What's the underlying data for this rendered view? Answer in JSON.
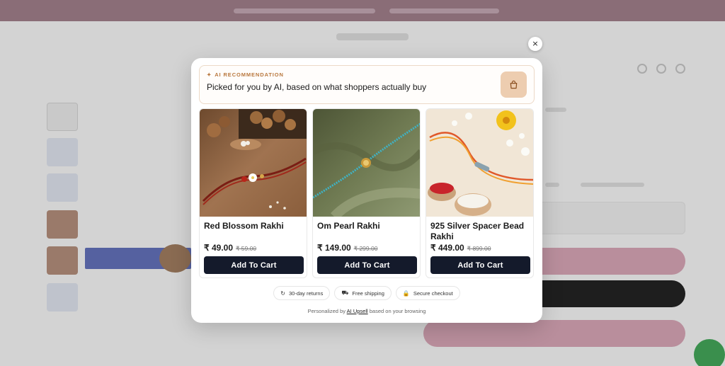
{
  "modal": {
    "close_label": "×",
    "eyebrow_icon": "✦",
    "eyebrow": "AI RECOMMENDATION",
    "headline": "Picked for you by AI, based on what shoppers actually buy",
    "bag_icon": "shopping-bag-icon",
    "products": [
      {
        "name": "Red Blossom Rakhi",
        "price": "₹ 49.00",
        "was": "₹ 59.00",
        "cta": "Add To Cart"
      },
      {
        "name": "Om Pearl Rakhi",
        "price": "₹ 149.00",
        "was": "₹ 299.00",
        "cta": "Add To Cart"
      },
      {
        "name": "925 Silver Spacer Bead Rakhi",
        "price": "₹ 449.00",
        "was": "₹ 899.00",
        "cta": "Add To Cart"
      }
    ],
    "badges": [
      {
        "icon": "↻",
        "label": "30-day returns"
      },
      {
        "icon": "⛟",
        "label": "Free shipping"
      },
      {
        "icon": "🔒",
        "label": "Secure checkout"
      }
    ],
    "footer_prefix": "Personalized by ",
    "footer_link": "AI Upsell",
    "footer_suffix": " based on your browsing"
  },
  "colors": {
    "accent": "#b9783e",
    "button_dark": "#141a2b",
    "bag_tile": "#edcdb0",
    "overlay": "#d3d3d3"
  }
}
